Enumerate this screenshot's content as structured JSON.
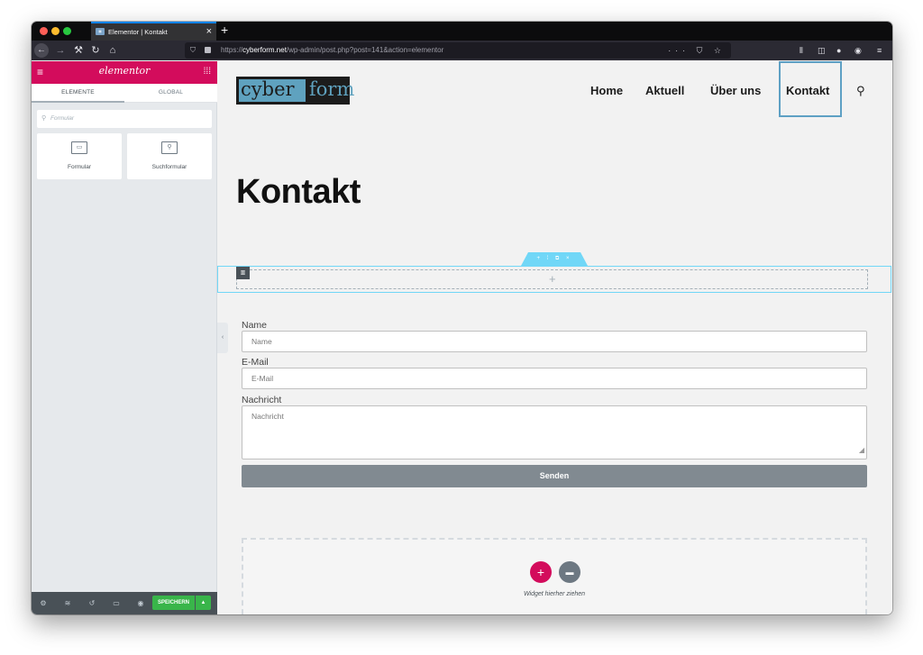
{
  "browser": {
    "tab_title": "Elementor | Kontakt",
    "tab_close": "×",
    "new_tab": "+",
    "url_host": "cyberform.net",
    "url_prefix": "https://",
    "url_path": "/wp-admin/post.php?post=141&action=elementor",
    "url_actions": "··· ⛉ ☆"
  },
  "panel": {
    "logo": "elementor",
    "tabs": [
      "ELEMENTE",
      "GLOBAL"
    ],
    "search_placeholder": "Formular",
    "widgets": [
      {
        "label": "Formular",
        "icon": "form-icon"
      },
      {
        "label": "Suchformular",
        "icon": "search-form-icon"
      }
    ],
    "save_label": "SPEICHERN"
  },
  "site": {
    "logo_left": "cyber",
    "logo_right": "form",
    "menu": [
      "Home",
      "Aktuell",
      "Über uns",
      "Kontakt"
    ],
    "active_menu": "Kontakt",
    "page_title": "Kontakt"
  },
  "form": {
    "fields": [
      {
        "label": "Name",
        "placeholder": "Name"
      },
      {
        "label": "E-Mail",
        "placeholder": "E-Mail"
      },
      {
        "label": "Nachricht",
        "placeholder": "Nachricht"
      }
    ],
    "submit": "Senden"
  },
  "drop_zone": {
    "label": "Widget hierher ziehen"
  },
  "colors": {
    "elementor_pink": "#d30c5c",
    "save_green": "#39b54a",
    "section_blue": "#71d7f7",
    "logo_blue": "#5fa2bf"
  }
}
